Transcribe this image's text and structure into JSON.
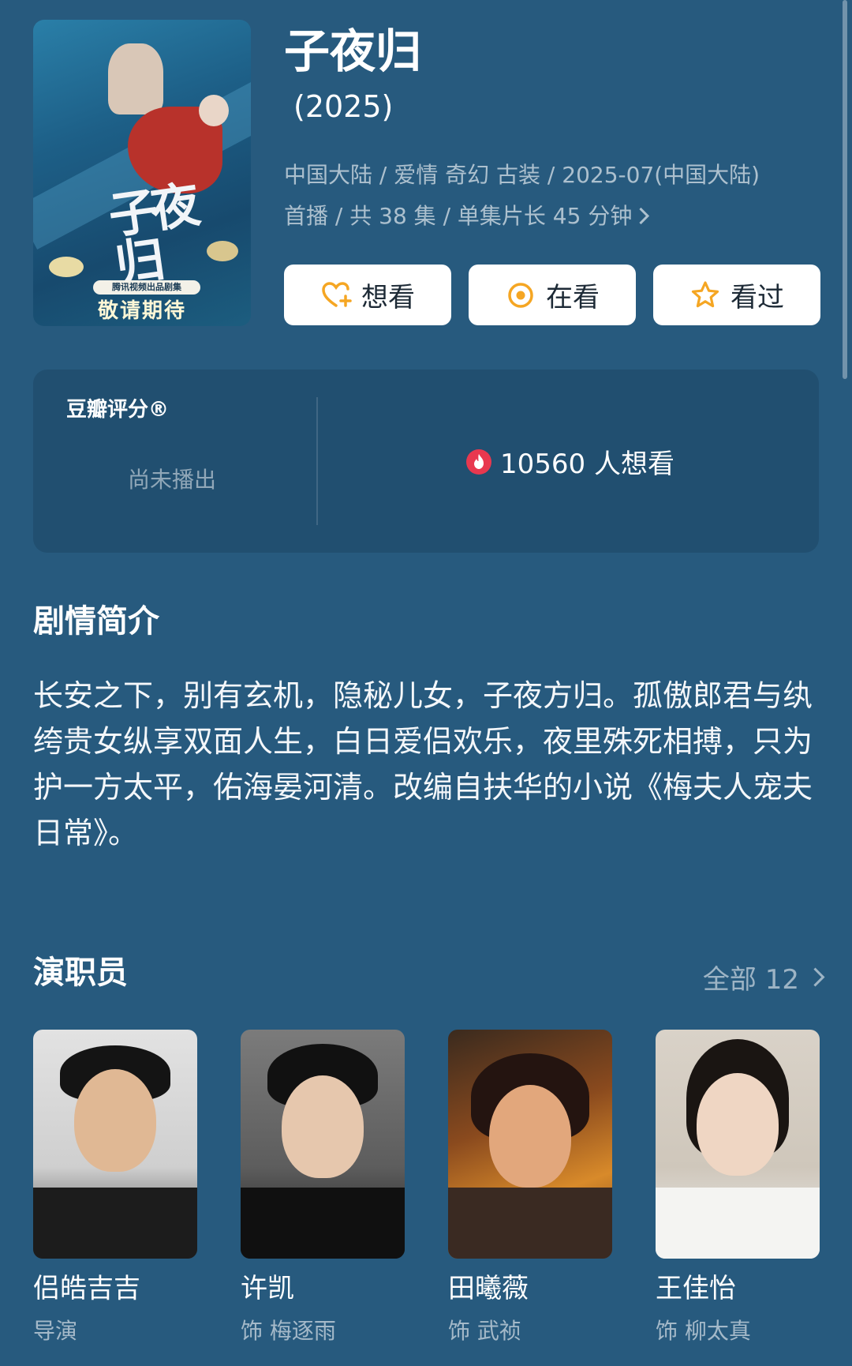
{
  "poster": {
    "calligraphy": "子夜归",
    "badge": "腾讯视频出品剧集",
    "tagline": "敬请期待"
  },
  "title": "子夜归",
  "year": "(2025)",
  "meta": {
    "line1": "中国大陆 / 爱情 奇幻 古装 / 2025-07(中国大陆)",
    "line2": "首播 / 共 38 集 / 单集片长 45 分钟"
  },
  "actions": [
    {
      "label": "想看",
      "icon": "heart-plus-icon"
    },
    {
      "label": "在看",
      "icon": "circle-dot-icon"
    },
    {
      "label": "看过",
      "icon": "star-icon"
    }
  ],
  "rating": {
    "label": "豆瓣评分®",
    "status": "尚未播出",
    "wish_text": "10560 人想看"
  },
  "synopsis": {
    "title": "剧情简介",
    "text": "长安之下，别有玄机，隐秘儿女，子夜方归。孤傲郎君与纨绔贵女纵享双面人生，白日爱侣欢乐，夜里殊死相搏，只为护一方太平，佑海晏河清。改编自扶华的小说《梅夫人宠夫日常》。"
  },
  "cast": {
    "title": "演职员",
    "all_label": "全部 12",
    "members": [
      {
        "name": "侣皓吉吉",
        "role": "导演"
      },
      {
        "name": "许凯",
        "role": "饰 梅逐雨"
      },
      {
        "name": "田曦薇",
        "role": "饰 武祯"
      },
      {
        "name": "王佳怡",
        "role": "饰 柳太真"
      }
    ]
  },
  "colors": {
    "background": "#275a7e",
    "card": "#214f70",
    "accent_orange": "#f5a623",
    "flame_red": "#e8384f"
  }
}
